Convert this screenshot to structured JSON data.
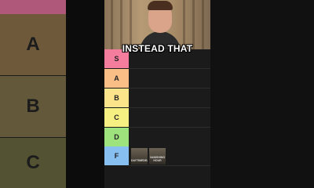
{
  "caption": "INSTEAD THAT",
  "background_tiers": [
    {
      "label": "",
      "color": "#b0587a"
    },
    {
      "label": "A",
      "color": "#6e5a3a"
    },
    {
      "label": "B",
      "color": "#63593a"
    },
    {
      "label": "C",
      "color": "#535232"
    }
  ],
  "tiers": [
    {
      "label": "S",
      "color": "#f47c9c",
      "items": []
    },
    {
      "label": "A",
      "color": "#f9bd86",
      "items": []
    },
    {
      "label": "B",
      "color": "#fbe48a",
      "items": []
    },
    {
      "label": "C",
      "color": "#f6ef82",
      "items": []
    },
    {
      "label": "D",
      "color": "#9ee27e",
      "items": []
    },
    {
      "label": "F",
      "color": "#86bff0",
      "items": [
        {
          "title": "DAYTIMEDEADLY",
          "icon": "game-thumbnail"
        },
        {
          "title": "VANISHING HOUR",
          "icon": "game-thumbnail"
        }
      ]
    }
  ]
}
